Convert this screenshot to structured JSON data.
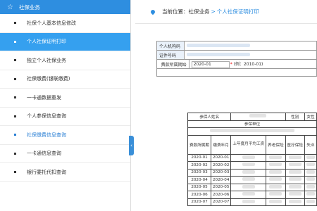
{
  "sidebar": {
    "header": "社保业务",
    "items": [
      {
        "label": "社保个人基本信息修改"
      },
      {
        "label": "个人社保证明打印"
      },
      {
        "label": "独立个人社保业务"
      },
      {
        "label": "社保缴费(银联缴费)"
      },
      {
        "label": "一卡通数据重发"
      },
      {
        "label": "个人参保信息查询"
      },
      {
        "label": "社保缴费信息查询"
      },
      {
        "label": "一卡通信息查询"
      },
      {
        "label": "银行委托代扣查询"
      }
    ]
  },
  "breadcrumb": {
    "prefix": "当前位置",
    "colon": "：",
    "section": "社保业务",
    "separator": ">",
    "current": "个人社保证明打印"
  },
  "form": {
    "org_code_label": "个人机构码",
    "id_label": "证件号码",
    "period_label": "费款所属期始",
    "period_value": "2020-01",
    "period_required": "*",
    "period_hint": "(例：2010-01)"
  },
  "report": {
    "name_label": "参保人姓名",
    "gender_label": "性别",
    "gender_value": "女性",
    "unit_label": "参保单位",
    "col_period": "费款所属期",
    "col_pay_month": "缴费年月",
    "col_avg_wage": "上年度月平均工资",
    "col_pension": "养老保险",
    "col_medical": "医疗保险",
    "col_unemployment": "失业",
    "rows": [
      {
        "period": "2020-01",
        "month": "2020-01"
      },
      {
        "period": "2020-02",
        "month": "2020-02"
      },
      {
        "period": "2020-03",
        "month": "2020-03"
      },
      {
        "period": "2020-04",
        "month": "2020-04"
      },
      {
        "period": "2020-05",
        "month": "2020-05"
      },
      {
        "period": "2020-06",
        "month": "2020-06"
      },
      {
        "period": "2020-07",
        "month": "2020-07"
      }
    ]
  },
  "colors": {
    "accent": "#2e8ee0",
    "active_item": "#35a0ef",
    "required": "#ee0000"
  },
  "icons": {
    "header": "star-outline-icon",
    "breadcrumb": "location-pin-icon",
    "collapse": "chevron-left-icon"
  }
}
